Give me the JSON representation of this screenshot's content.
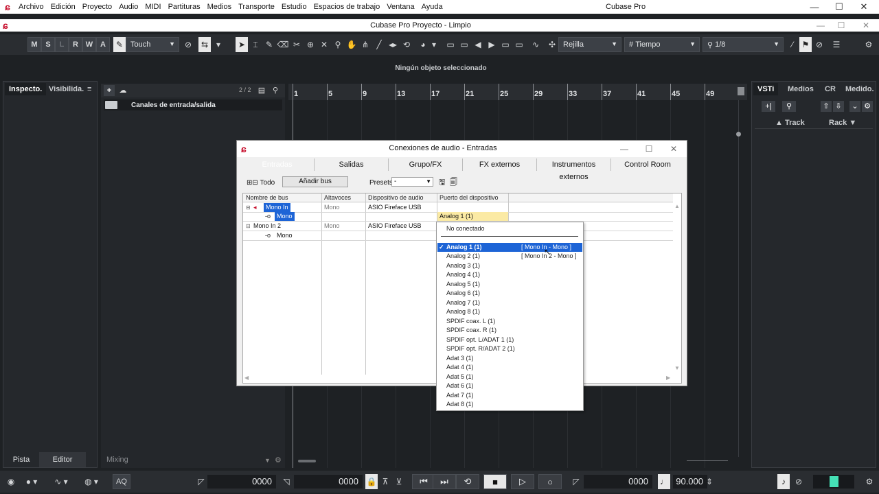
{
  "menubar": {
    "items": [
      "Archivo",
      "Edición",
      "Proyecto",
      "Audio",
      "MIDI",
      "Partituras",
      "Medios",
      "Transporte",
      "Estudio",
      "Espacios de trabajo",
      "Ventana",
      "Ayuda"
    ],
    "app_title": "Cubase Pro",
    "minimize": "—",
    "maximize": "☐",
    "close": "✕"
  },
  "project": {
    "title": "Cubase Pro Proyecto - Limpio"
  },
  "toolbar": {
    "buttons": [
      "M",
      "S",
      "L",
      "R",
      "W",
      "A"
    ],
    "automation_mode": "Touch",
    "snap_type": "Rejilla",
    "grid_type": "Tiempo",
    "quantize": "1/8"
  },
  "status": {
    "text": "Ningún objeto seleccionado"
  },
  "inspector": {
    "tab_inspector": "Inspecto.",
    "tab_visibility": "Visibilida.",
    "menu_icon": "≡",
    "bottom_tab_track": "Pista",
    "bottom_tab_editor": "Editor"
  },
  "tracklist": {
    "count": "2 / 2",
    "folder_track": "Canales de entrada/salida",
    "footer": "Mixing"
  },
  "ruler": {
    "bars": [
      "1",
      "5",
      "9",
      "13",
      "17",
      "21",
      "25",
      "29",
      "33",
      "37",
      "41",
      "45",
      "49"
    ]
  },
  "right_zone": {
    "tabs": [
      "VSTi",
      "Medios",
      "CR",
      "Medido."
    ],
    "track_col": "Track",
    "rack_col": "Rack"
  },
  "transport": {
    "left_locator": "0000",
    "right_locator": "0000",
    "position": "0000",
    "tempo": "90.000",
    "aq": "AQ"
  },
  "dialog": {
    "title": "Conexiones de audio - Entradas",
    "tabs": [
      "Entradas",
      "Salidas",
      "Grupo/FX",
      "FX externos",
      "Instrumentos externos",
      "Control Room"
    ],
    "all_label": "Todo",
    "add_bus": "Añadir bus",
    "presets_label": "Presets",
    "presets_value": "-",
    "columns": [
      "Nombre de bus",
      "Altavoces",
      "Dispositivo de audio",
      "Puerto del dispositivo"
    ],
    "rows": [
      {
        "name": "Mono In",
        "speakers": "Mono",
        "device": "ASIO Fireface USB",
        "port": ""
      },
      {
        "name": "Mono",
        "speakers": "",
        "device": "",
        "port": "Analog 1 (1)"
      },
      {
        "name": "Mono In 2",
        "speakers": "Mono",
        "device": "ASIO Fireface USB",
        "port": ""
      },
      {
        "name": "Mono",
        "speakers": "",
        "device": "",
        "port": ""
      }
    ]
  },
  "popup": {
    "not_connected": "No conectado",
    "items": [
      {
        "label": "Analog 1 (1)",
        "extra": "[ Mono In - Mono ]",
        "selected": true
      },
      {
        "label": "Analog 2 (1)",
        "extra": "[ Mono In 2 - Mono ]",
        "selected": false
      },
      {
        "label": "Analog 3 (1)"
      },
      {
        "label": "Analog 4 (1)"
      },
      {
        "label": "Analog 5 (1)"
      },
      {
        "label": "Analog 6 (1)"
      },
      {
        "label": "Analog 7 (1)"
      },
      {
        "label": "Analog 8 (1)"
      },
      {
        "label": "SPDIF coax. L (1)"
      },
      {
        "label": "SPDIF coax. R (1)"
      },
      {
        "label": "SPDIF opt. L/ADAT 1 (1)"
      },
      {
        "label": "SPDIF opt. R/ADAT 2 (1)"
      },
      {
        "label": "Adat 3 (1)"
      },
      {
        "label": "Adat 4 (1)"
      },
      {
        "label": "Adat 5 (1)"
      },
      {
        "label": "Adat 6 (1)"
      },
      {
        "label": "Adat 7 (1)"
      },
      {
        "label": "Adat 8 (1)"
      }
    ]
  }
}
